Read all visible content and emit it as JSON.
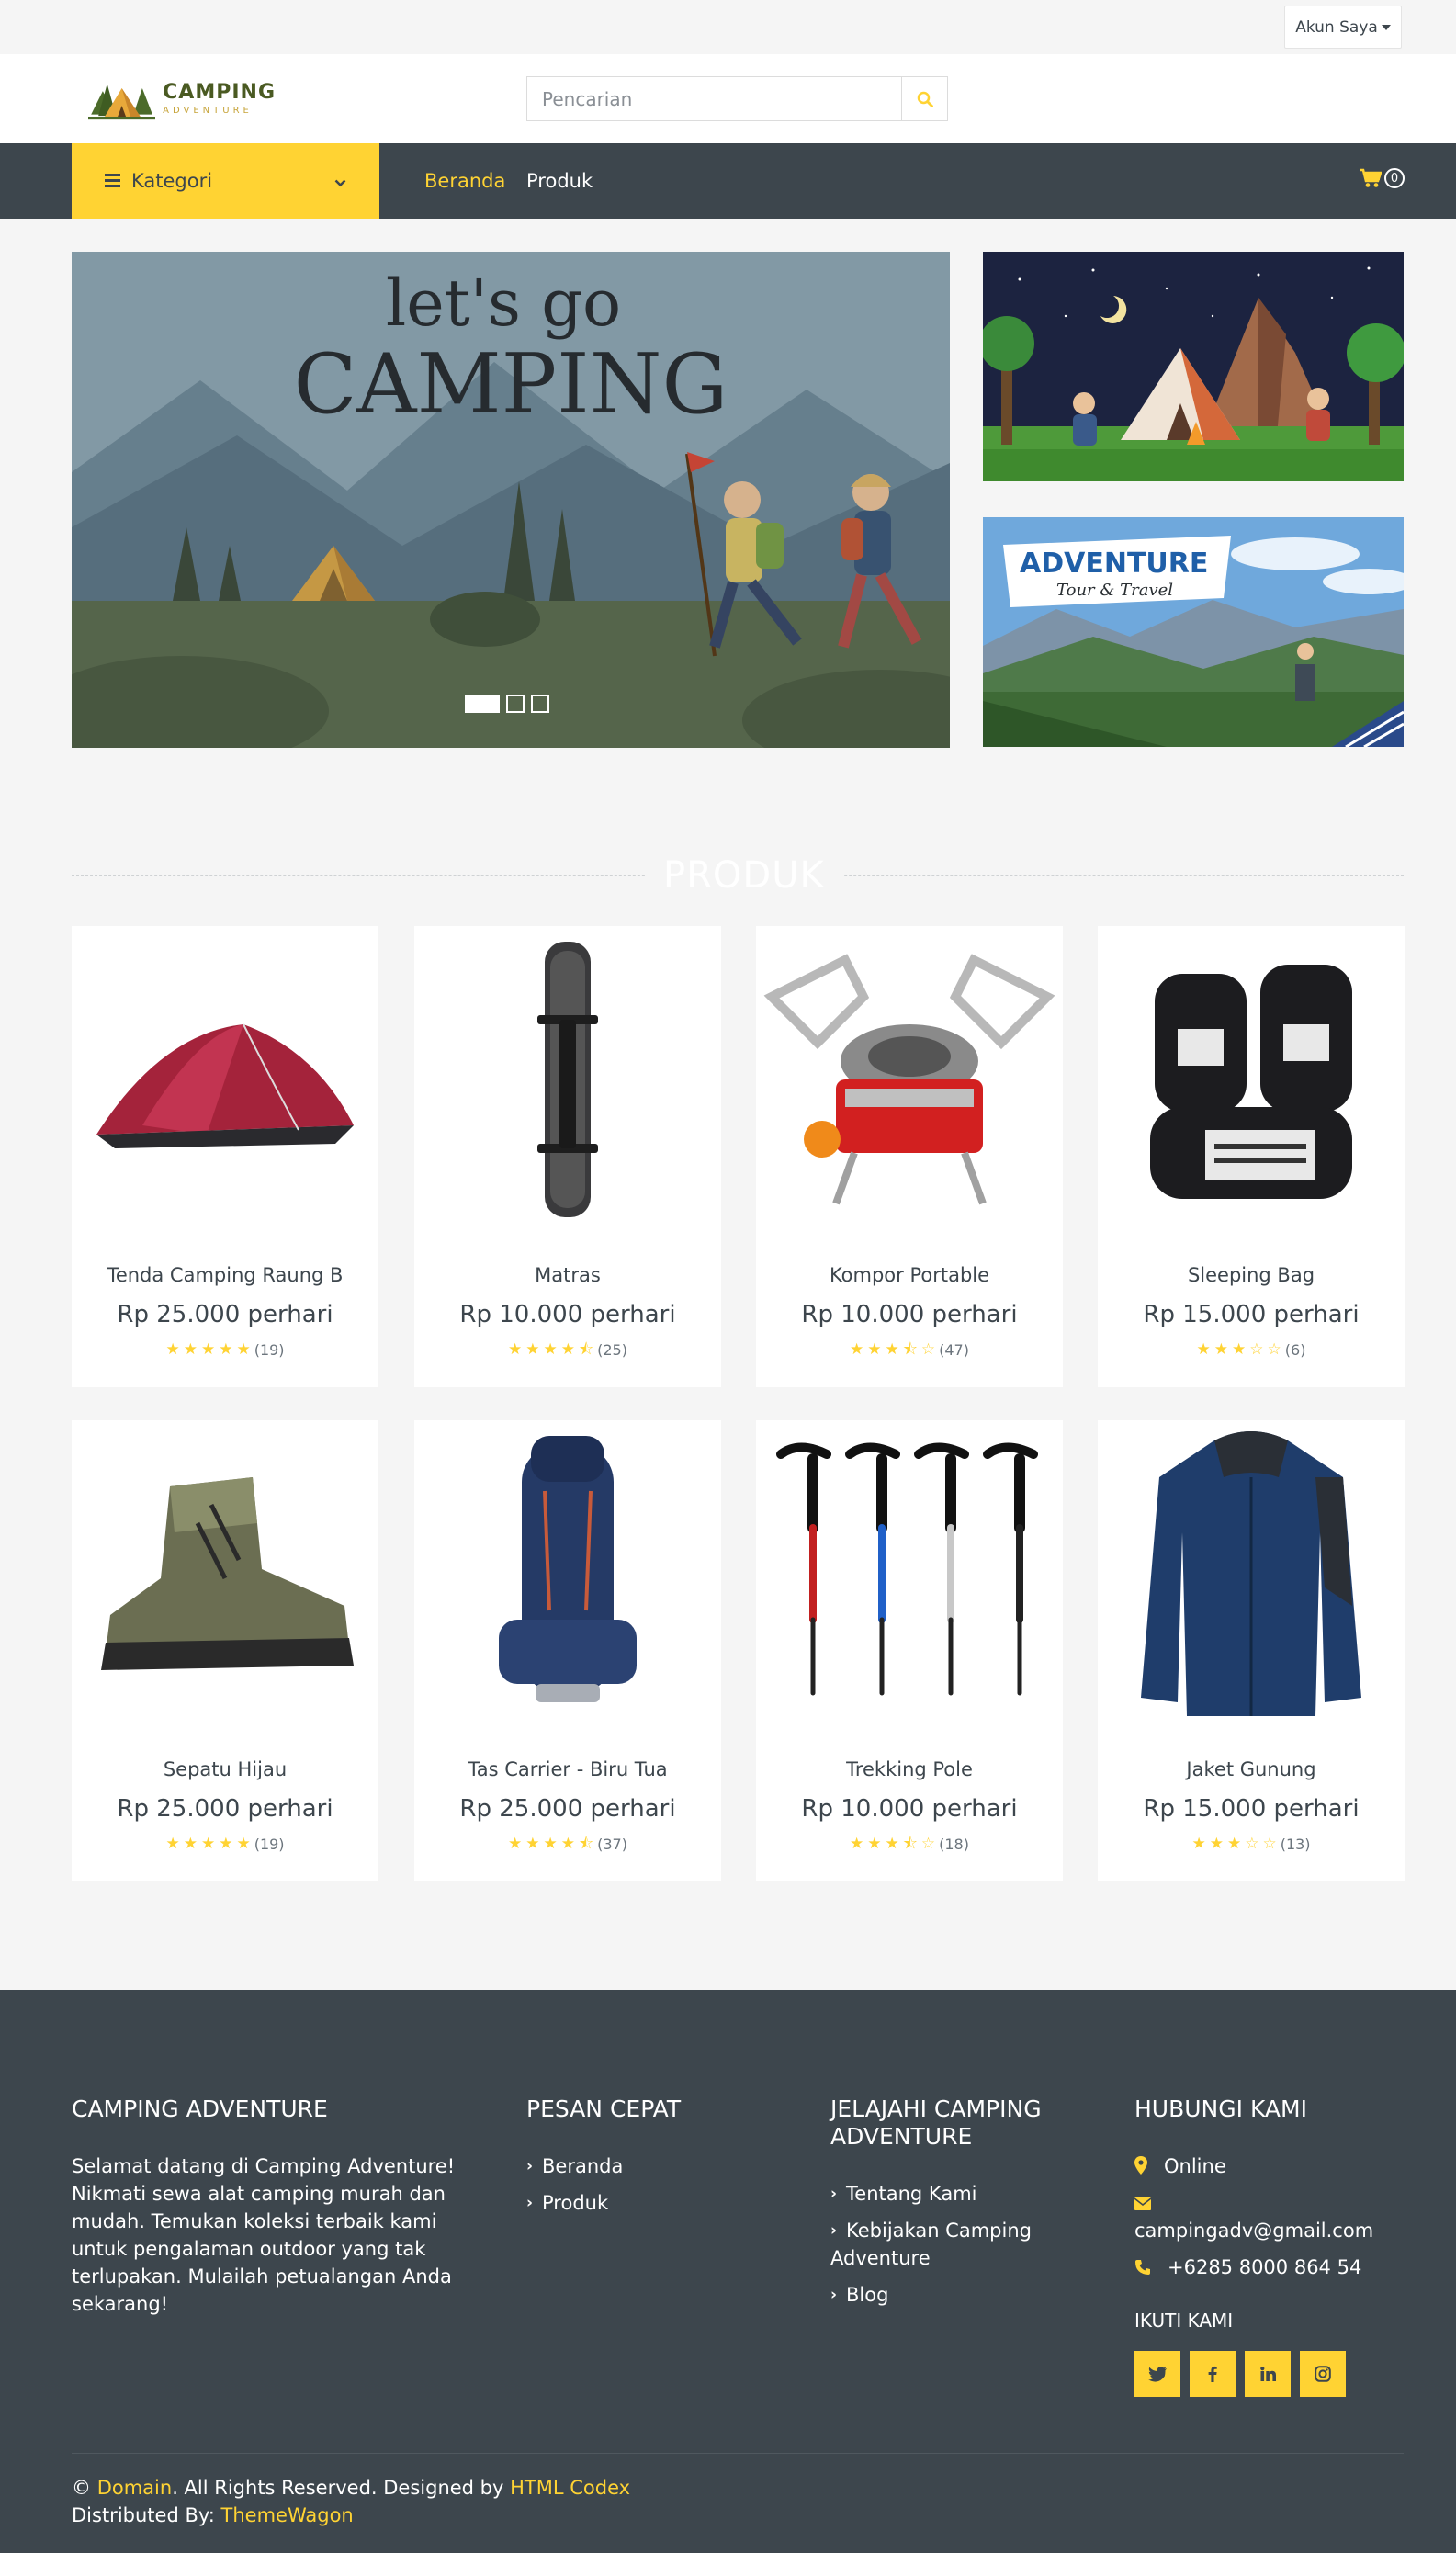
{
  "topbar": {
    "account_label": "Akun Saya"
  },
  "header": {
    "logo_main": "CAMPING",
    "logo_sub": "ADVENTURE",
    "search_placeholder": "Pencarian"
  },
  "nav": {
    "category_label": "Kategori",
    "links": [
      "Beranda",
      "Produk"
    ],
    "active": "Beranda",
    "cart_count": "0"
  },
  "hero": {
    "slide_line1": "let's go",
    "slide_line2": "CAMPING",
    "slide_count": 3,
    "active_slide": 1,
    "banner2_title": "ADVENTURE",
    "banner2_sub": "Tour & Travel"
  },
  "products_section": {
    "title": "PRODUK",
    "items": [
      {
        "name": "Tenda Camping Raung B",
        "price": "Rp 25.000 perhari",
        "rating": 5,
        "reviews": "(19)"
      },
      {
        "name": "Matras",
        "price": "Rp 10.000 perhari",
        "rating": 4.5,
        "reviews": "(25)"
      },
      {
        "name": "Kompor Portable",
        "price": "Rp 10.000 perhari",
        "rating": 3.5,
        "reviews": "(47)"
      },
      {
        "name": "Sleeping Bag",
        "price": "Rp 15.000 perhari",
        "rating": 3,
        "reviews": "(6)"
      },
      {
        "name": "Sepatu Hijau",
        "price": "Rp 25.000 perhari",
        "rating": 5,
        "reviews": "(19)"
      },
      {
        "name": "Tas Carrier - Biru Tua",
        "price": "Rp 25.000 perhari",
        "rating": 4.5,
        "reviews": "(37)"
      },
      {
        "name": "Trekking Pole",
        "price": "Rp 10.000 perhari",
        "rating": 3.5,
        "reviews": "(18)"
      },
      {
        "name": "Jaket Gunung",
        "price": "Rp 15.000 perhari",
        "rating": 3,
        "reviews": "(13)"
      }
    ]
  },
  "footer": {
    "about_title": "CAMPING ADVENTURE",
    "about_lines": [
      "Selamat datang di Camping Adventure!",
      "Nikmati sewa alat camping murah dan",
      "mudah. Temukan koleksi terbaik kami",
      "untuk pengalaman outdoor yang tak",
      "terlupakan. Mulailah petualangan Anda",
      "sekarang!"
    ],
    "quick_title": "PESAN CEPAT",
    "quick_links": [
      "Beranda",
      "Produk"
    ],
    "explore_title_1": "JELAJAHI CAMPING",
    "explore_title_2": "ADVENTURE",
    "explore_link_1": "Tentang Kami",
    "explore_link_2a": "Kebijakan Camping",
    "explore_link_2b": "Adventure",
    "explore_link_3": "Blog",
    "contact_title": "HUBUNGI KAMI",
    "contact_status": "Online",
    "contact_email": "campingadv@gmail.com",
    "contact_phone": "+6285 8000 864 54",
    "follow_title": "IKUTI KAMI",
    "copyright_prefix": "©",
    "copyright_domain": "Domain",
    "copyright_mid": ". All Rights Reserved. Designed by",
    "copyright_designer": "HTML Codex",
    "distributed_prefix": "Distributed By:",
    "distributed_name": "ThemeWagon"
  },
  "colors": {
    "accent": "#ffd333",
    "dark": "#3d464d",
    "bg": "#f5f5f5"
  }
}
